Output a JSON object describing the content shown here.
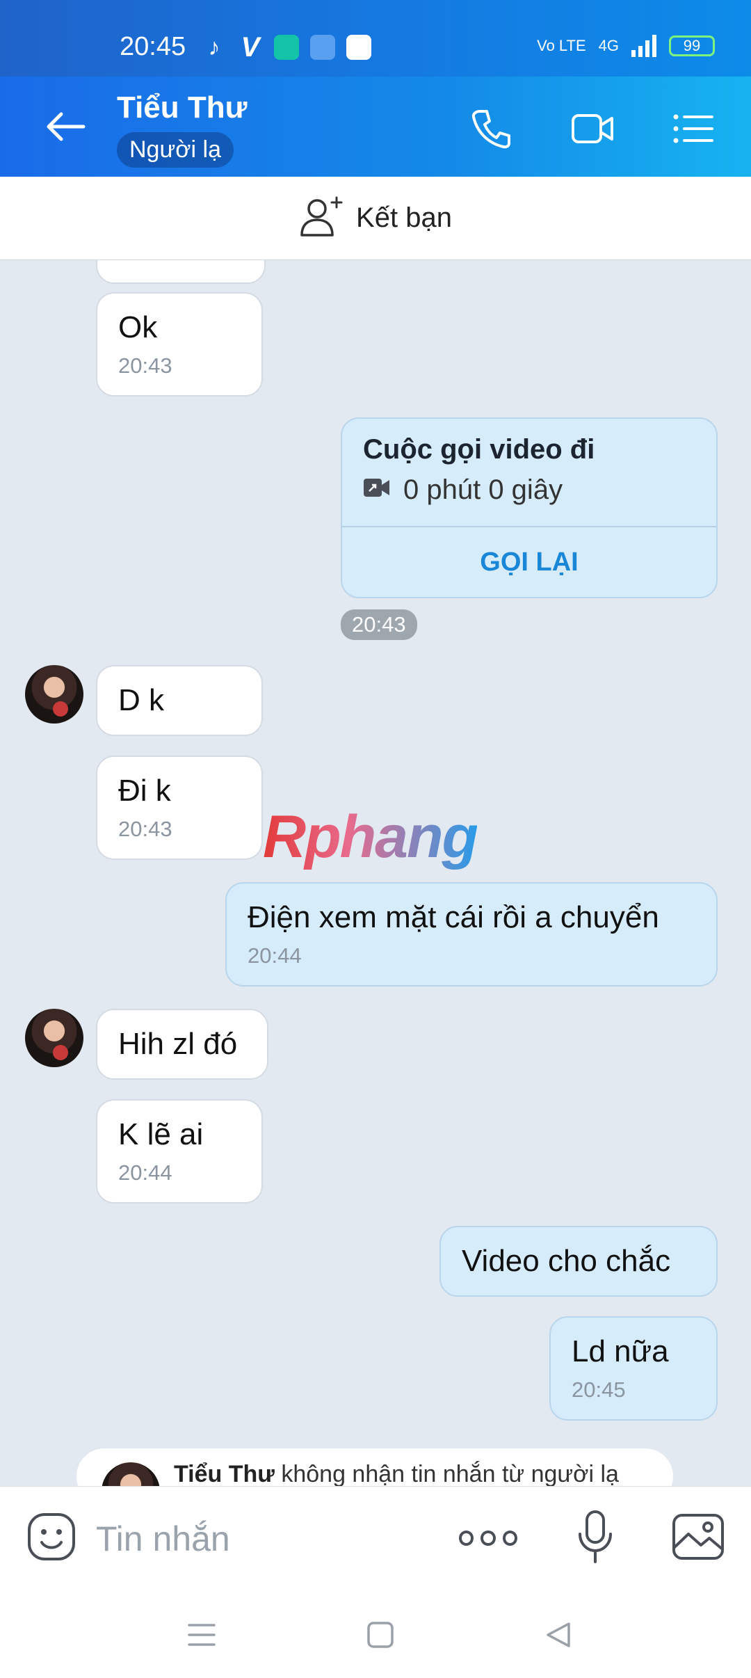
{
  "status_bar": {
    "time": "20:45",
    "network_label": "Vo LTE",
    "signal_label": "4G",
    "battery": "99"
  },
  "header": {
    "contact_name": "Tiểu Thư",
    "status_tag": "Người lạ"
  },
  "add_friend": {
    "label": "Kết bạn"
  },
  "messages": [
    {
      "side": "in",
      "text": "Ok",
      "time": "20:43"
    },
    {
      "side": "out",
      "type": "call",
      "title": "Cuộc gọi video đi",
      "duration": "0 phút 0 giây",
      "action": "GỌI LẠI",
      "time": "20:43"
    },
    {
      "side": "in",
      "text": "D k",
      "time": ""
    },
    {
      "side": "in",
      "text": "Đi k",
      "time": "20:43"
    },
    {
      "side": "out",
      "text": "Điện xem mặt cái rồi a chuyển",
      "time": "20:44"
    },
    {
      "side": "in",
      "text": "Hih zl đó",
      "time": ""
    },
    {
      "side": "in",
      "text": "K lẽ ai",
      "time": "20:44"
    },
    {
      "side": "out",
      "text": "Video cho chắc",
      "time": ""
    },
    {
      "side": "out",
      "text": "Ld nữa",
      "time": "20:45"
    }
  ],
  "notice": {
    "name": "Tiểu Thư",
    "text": " không nhận tin nhắn từ người lạ"
  },
  "watermark": "Rphang",
  "input": {
    "placeholder": "Tin nhắn"
  },
  "colors": {
    "header_start": "#1a6be8",
    "header_end": "#16b3f0",
    "outgoing_bubble": "#d6ecfb",
    "incoming_bubble": "#ffffff",
    "chat_background": "#e2e9f1",
    "action_text": "#1a86d8"
  },
  "icons": {
    "back": "arrow-left-icon",
    "call": "phone-icon",
    "video": "video-camera-icon",
    "menu": "list-menu-icon",
    "add_friend": "add-user-icon",
    "emoji": "emoji-icon",
    "more": "more-dots-icon",
    "mic": "microphone-icon",
    "image": "image-icon"
  }
}
